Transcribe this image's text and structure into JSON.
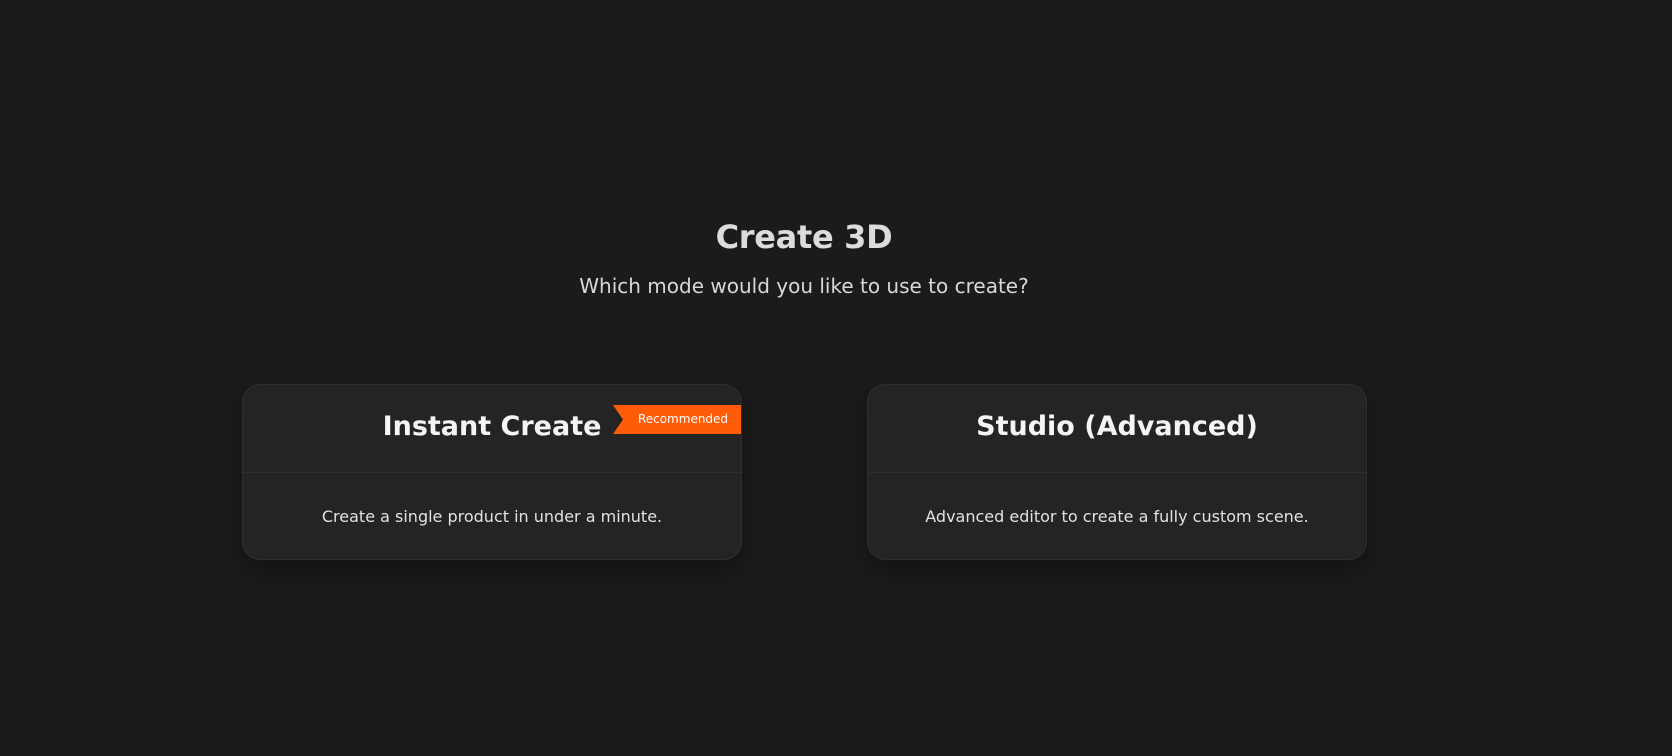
{
  "header": {
    "title": "Create 3D",
    "subtitle": "Which mode would you like to use to create?"
  },
  "modes": [
    {
      "title": "Instant Create",
      "description": "Create a single product in under a minute.",
      "badge": "Recommended"
    },
    {
      "title": "Studio (Advanced)",
      "description": "Advanced editor to create a fully custom scene."
    }
  ],
  "colors": {
    "background": "#1b1b1b",
    "card": "#242424",
    "accent": "#ff5c0a"
  }
}
